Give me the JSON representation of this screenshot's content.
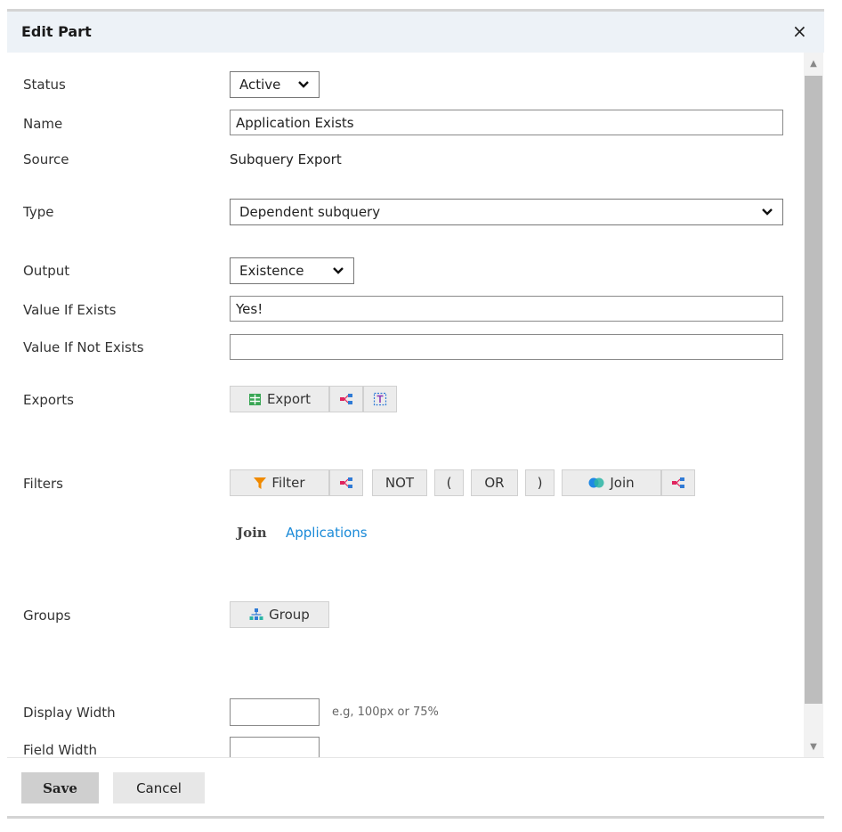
{
  "dialog": {
    "title": "Edit Part",
    "close_symbol": "×"
  },
  "form": {
    "status": {
      "label": "Status",
      "value": "Active"
    },
    "name": {
      "label": "Name",
      "value": "Application Exists"
    },
    "source": {
      "label": "Source",
      "value": "Subquery Export"
    },
    "type": {
      "label": "Type",
      "value": "Dependent subquery"
    },
    "output": {
      "label": "Output",
      "value": "Existence"
    },
    "value_if_exists": {
      "label": "Value If Exists",
      "value": "Yes!"
    },
    "value_if_not_exists": {
      "label": "Value If Not Exists",
      "value": ""
    },
    "exports": {
      "label": "Exports",
      "export_button": "Export"
    },
    "filters": {
      "label": "Filters",
      "filter_button": "Filter",
      "not_button": "NOT",
      "open_paren_button": "(",
      "or_button": "OR",
      "close_paren_button": ")",
      "join_button": "Join",
      "join_row": {
        "label": "Join",
        "link": "Applications"
      }
    },
    "groups": {
      "label": "Groups",
      "group_button": "Group"
    },
    "display_width": {
      "label": "Display Width",
      "value": "",
      "hint": "e.g, 100px or 75%"
    },
    "field_width": {
      "label": "Field Width",
      "value": ""
    }
  },
  "footer": {
    "save_label": "Save",
    "cancel_label": "Cancel"
  },
  "colors": {
    "header_bg": "#edf2f7",
    "link": "#1a8ad8",
    "filter_icon": "#f08a00",
    "tree_icon_pink": "#e0245e",
    "tree_icon_blue": "#2f7bd6",
    "join_icon_blue": "#1e88e5",
    "join_icon_teal": "#2bb5a5",
    "export_icon": "#3aa655",
    "group_icon": "#2f7bd6"
  }
}
